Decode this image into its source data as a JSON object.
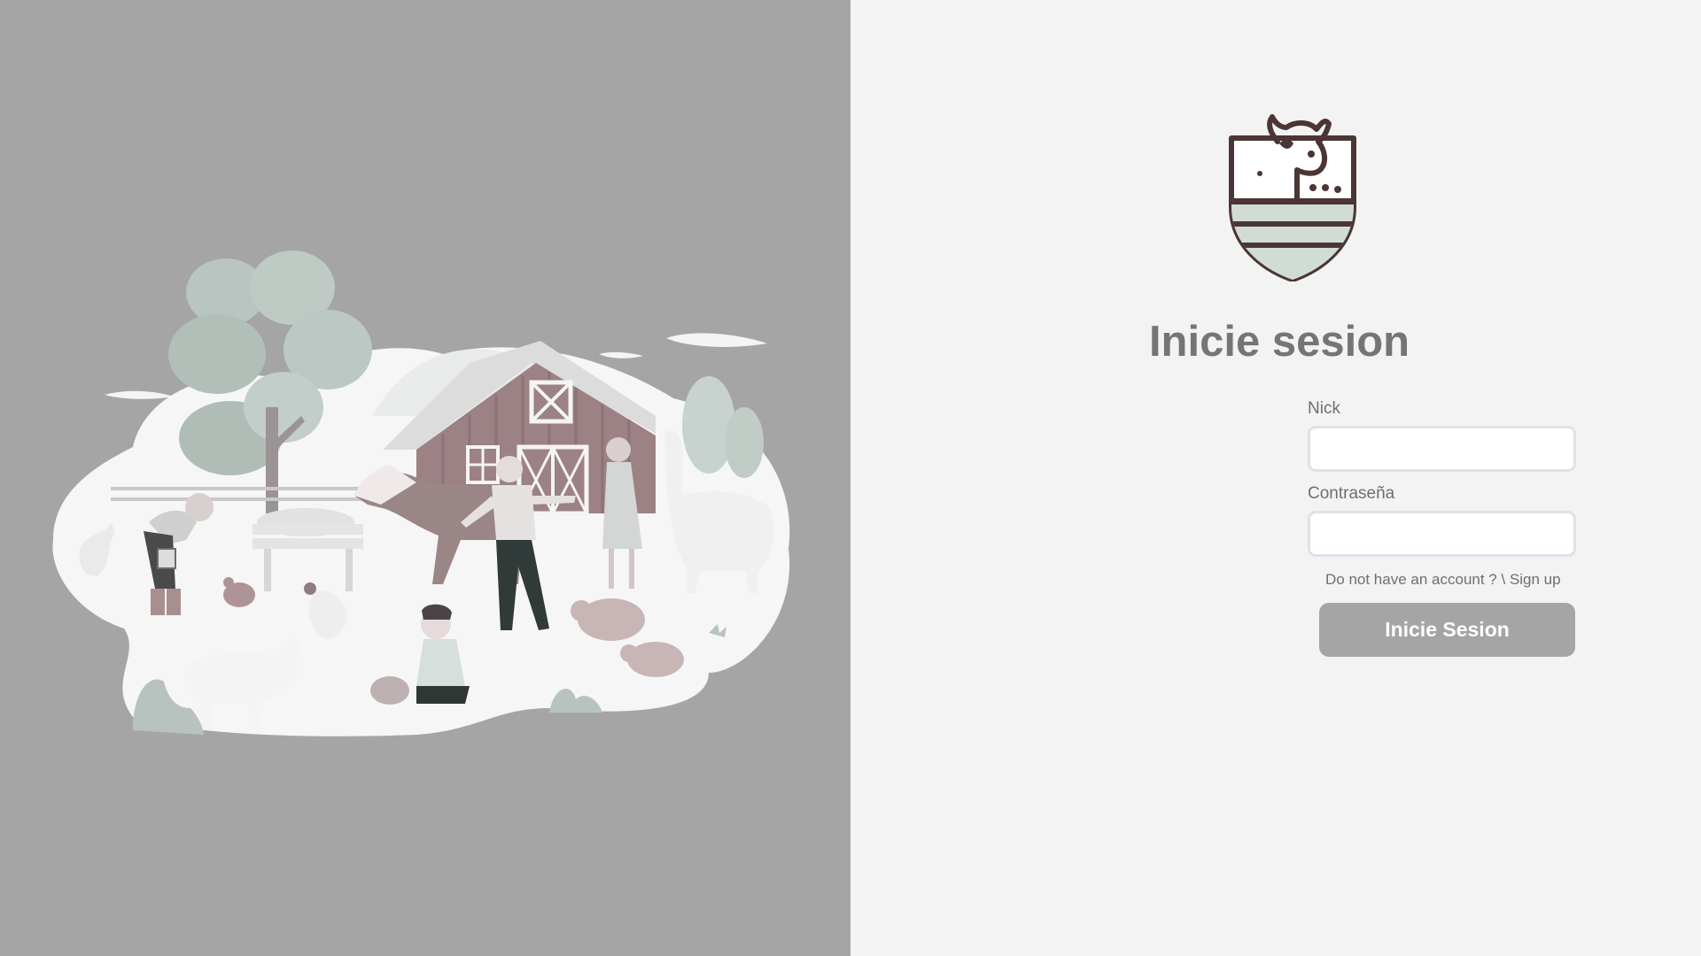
{
  "illustration": {
    "icon": "farm-illustration",
    "background_color": "#a5a5a5"
  },
  "logo": {
    "icon": "cow-shield-logo-icon"
  },
  "login": {
    "title": "Inicie sesion",
    "nick_label": "Nick",
    "nick_value": "",
    "password_label": "Contraseña",
    "password_value": "",
    "signup_prompt": "Do not have an account ? \\",
    "signup_link": "Sign up",
    "submit_label": "Inicie Sesion"
  },
  "colors": {
    "panel_background": "#f3f3f3",
    "button_background": "#a5a5a5",
    "title_color": "#757575",
    "input_border": "#dde2ea"
  }
}
